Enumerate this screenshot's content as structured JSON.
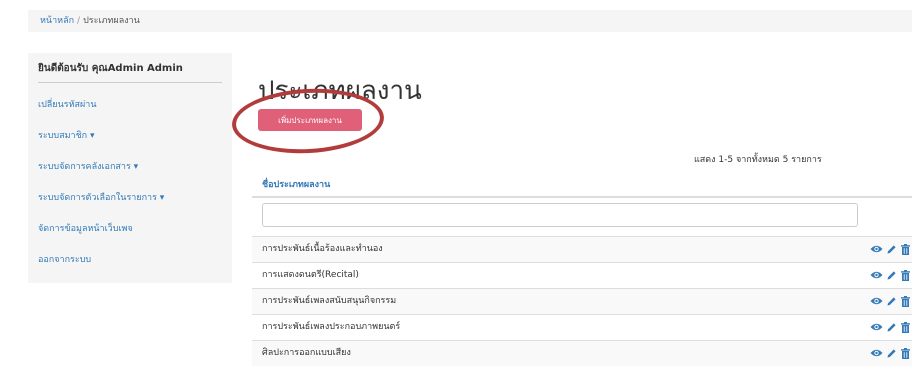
{
  "breadcrumb": {
    "home": "หน้าหลัก",
    "separator": "/",
    "current": "ประเภทผลงาน"
  },
  "sidebar": {
    "welcome": "ยินดีต้อนรับ คุณAdmin Admin",
    "items": [
      {
        "label": "เปลี่ยนรหัสผ่าน"
      },
      {
        "label": "ระบบสมาชิก ▾"
      },
      {
        "label": "ระบบจัดการคลังเอกสาร ▾"
      },
      {
        "label": "ระบบจัดการตัวเลือกในรายการ ▾"
      },
      {
        "label": "จัดการข้อมูลหน้าเว็บเพจ"
      },
      {
        "label": "ออกจากระบบ"
      }
    ]
  },
  "main": {
    "title": "ประเภทผลงาน",
    "add_button": "เพิ่มประเภทผลงาน",
    "summary": "แสดง 1-5 จากทั้งหมด 5 รายการ",
    "column_header": "ชื่อประเภทผลงาน",
    "filter_value": "",
    "rows": [
      {
        "name": "การประพันธ์เนื้อร้องและทำนอง"
      },
      {
        "name": "การแสดงดนตรี(Recital)"
      },
      {
        "name": "การประพันธ์เพลงสนับสนุนกิจกรรม"
      },
      {
        "name": "การประพันธ์เพลงประกอบภาพยนตร์"
      },
      {
        "name": "ศิลปะการออกแบบเสียง"
      }
    ]
  },
  "colors": {
    "link": "#337ab7",
    "button": "#e0607a",
    "annotation": "#b23c3c",
    "panel": "#f5f5f5"
  },
  "icons": {
    "view": "eye-icon",
    "edit": "pencil-icon",
    "delete": "trash-icon"
  }
}
